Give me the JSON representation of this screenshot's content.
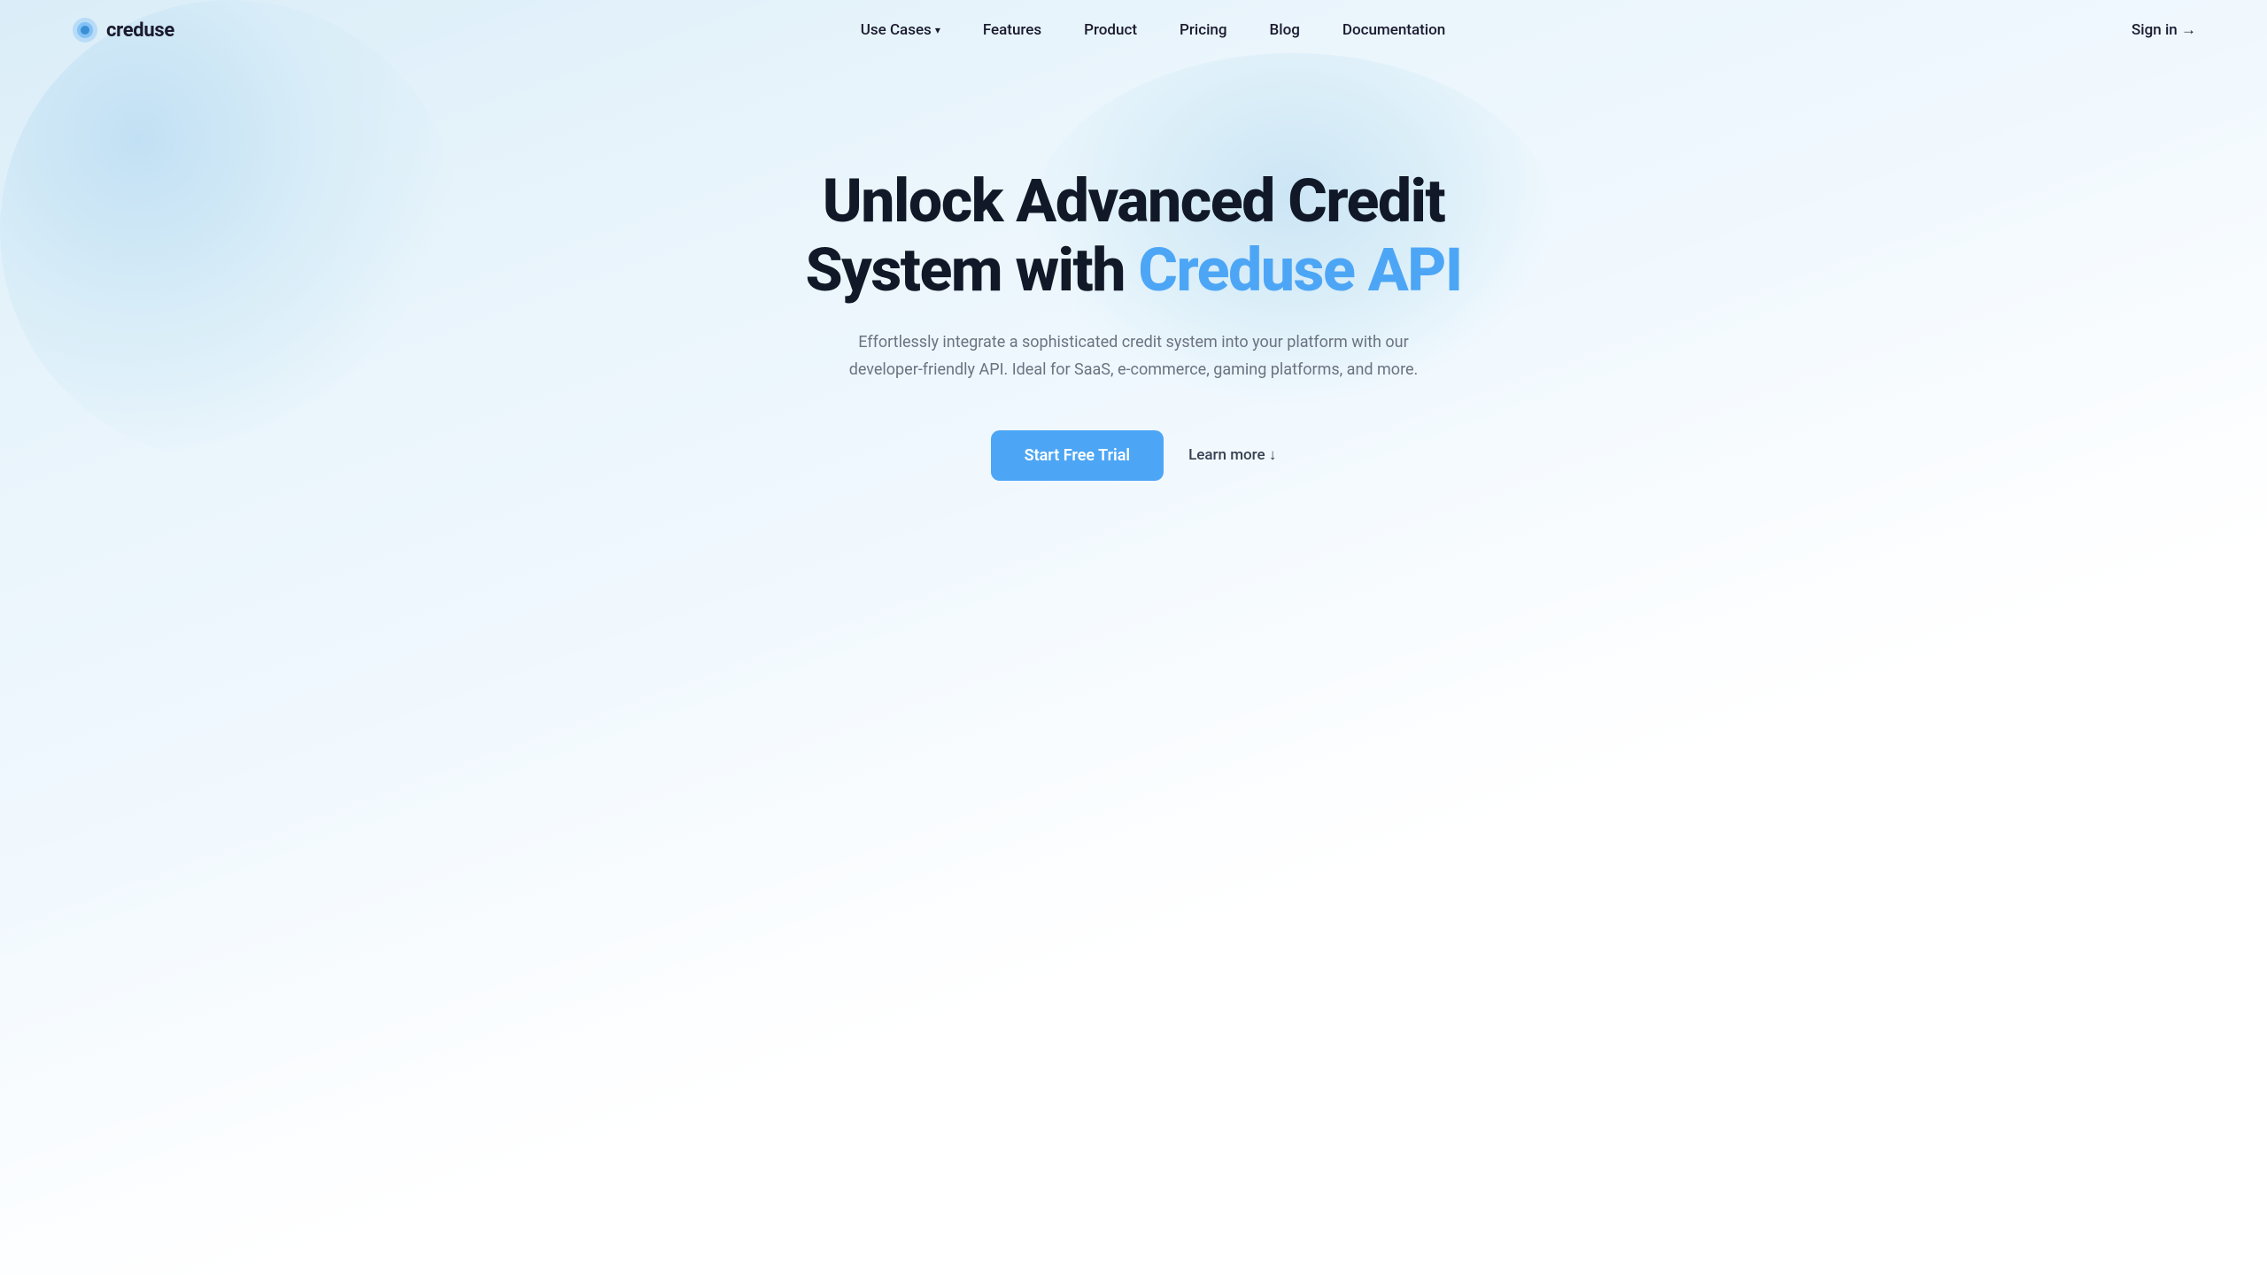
{
  "brand": {
    "logo_text": "creduse",
    "logo_icon": "circle-dot"
  },
  "nav": {
    "links": [
      {
        "label": "Use Cases",
        "has_dropdown": true,
        "href": "#"
      },
      {
        "label": "Features",
        "has_dropdown": false,
        "href": "#"
      },
      {
        "label": "Product",
        "has_dropdown": false,
        "href": "#"
      },
      {
        "label": "Pricing",
        "has_dropdown": false,
        "href": "#"
      },
      {
        "label": "Blog",
        "has_dropdown": false,
        "href": "#"
      },
      {
        "label": "Documentation",
        "has_dropdown": false,
        "href": "#"
      }
    ],
    "signin_label": "Sign in →"
  },
  "hero": {
    "title_part1": "Unlock Advanced Credit",
    "title_part2": "System with ",
    "title_highlight": "Creduse API",
    "subtitle": "Effortlessly integrate a sophisticated credit system into your platform with our developer-friendly API. Ideal for SaaS, e-commerce, gaming platforms, and more.",
    "cta_primary": "Start Free Trial",
    "cta_secondary": "Learn more ↓"
  },
  "colors": {
    "accent": "#4da6f5",
    "dark": "#1a1a2e",
    "text": "#374151",
    "muted": "#6b7280"
  }
}
